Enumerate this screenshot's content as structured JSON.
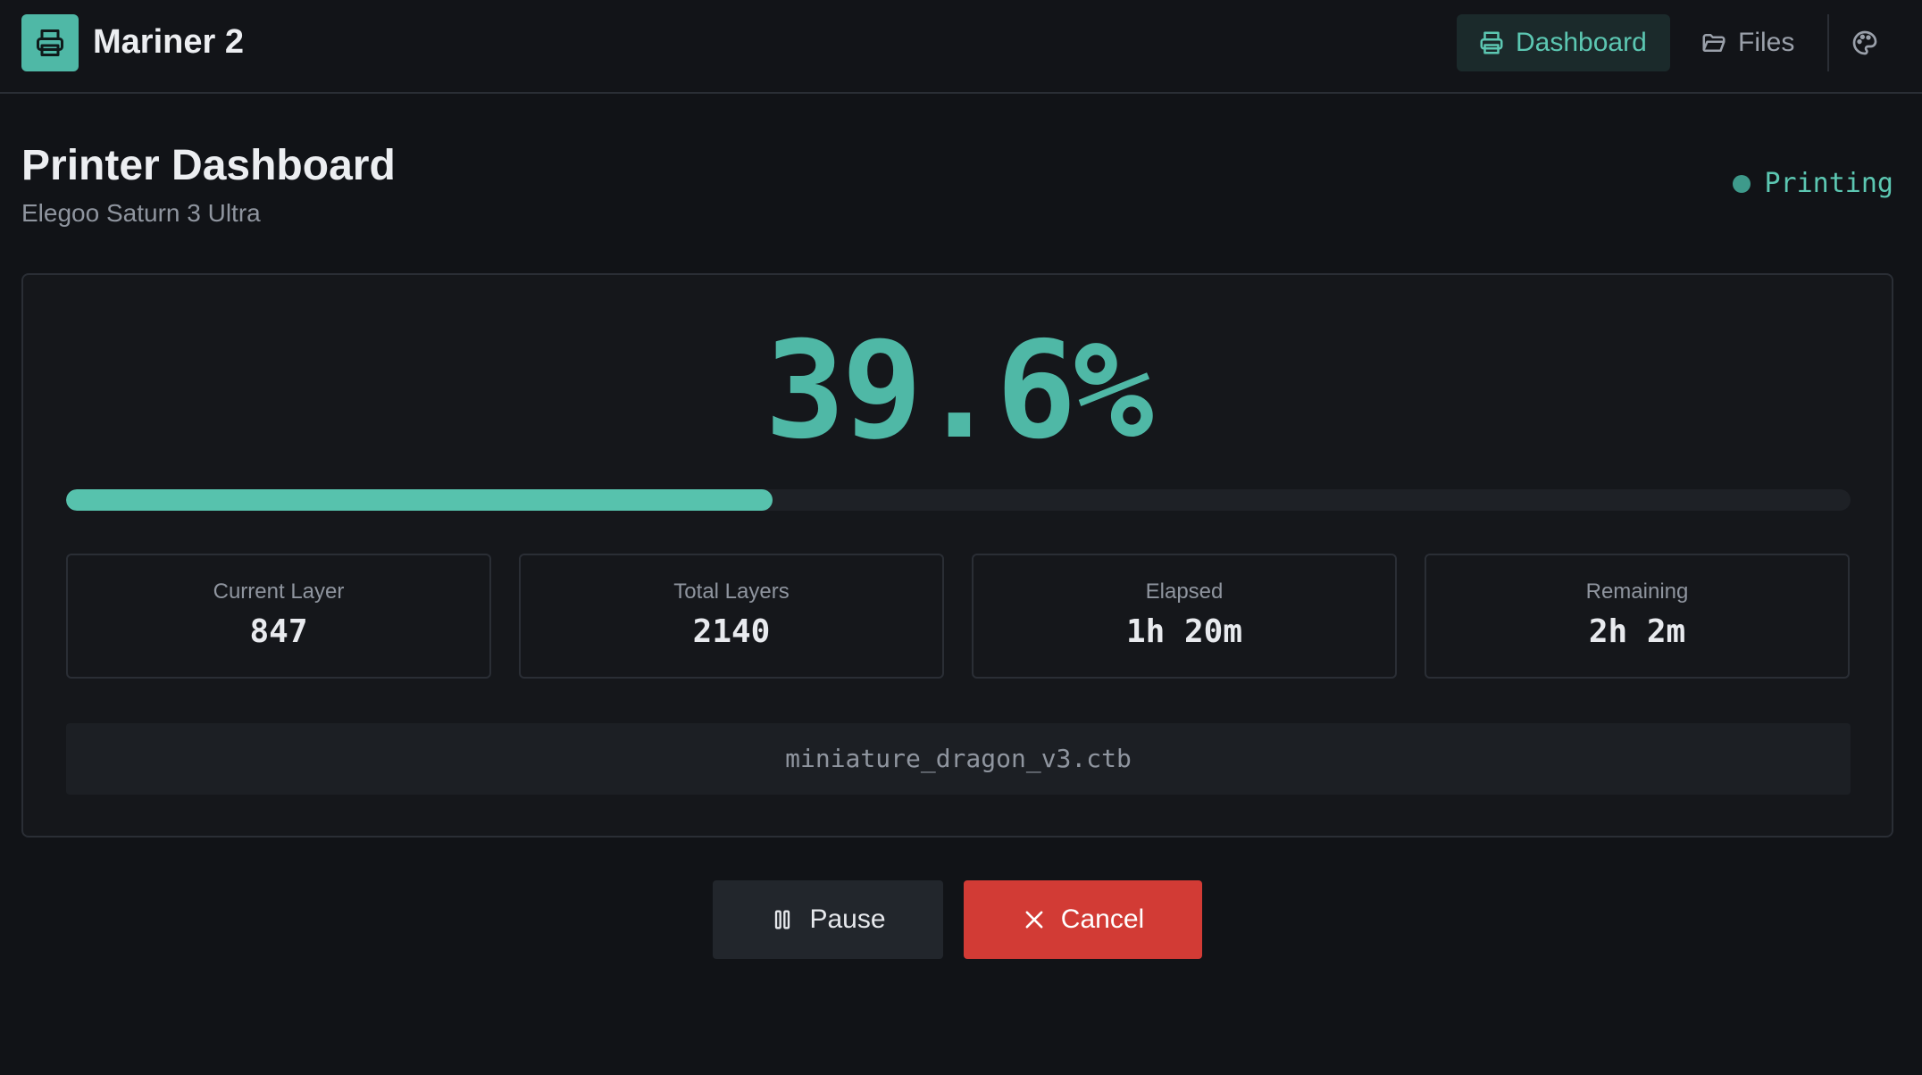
{
  "header": {
    "app_title": "Mariner 2",
    "logo_icon": "printer-icon",
    "nav": [
      {
        "label": "Dashboard",
        "icon": "printer-icon",
        "active": true
      },
      {
        "label": "Files",
        "icon": "folder-open-icon",
        "active": false
      }
    ],
    "theme_icon": "palette-icon"
  },
  "page": {
    "title": "Printer Dashboard",
    "subtitle": "Elegoo Saturn 3 Ultra",
    "status": "Printing"
  },
  "progress": {
    "percent_label": "39.6%",
    "value": 0.396
  },
  "stats": [
    {
      "label": "Current Layer",
      "value": "847"
    },
    {
      "label": "Total Layers",
      "value": "2140"
    },
    {
      "label": "Elapsed",
      "value": "1h 20m"
    },
    {
      "label": "Remaining",
      "value": "2h 2m"
    }
  ],
  "file": {
    "name": "miniature_dragon_v3.ctb"
  },
  "actions": {
    "pause_label": "Pause",
    "cancel_label": "Cancel"
  },
  "colors": {
    "accent": "#4fb8a6",
    "cancel": "#d23b35",
    "background": "#111317"
  }
}
